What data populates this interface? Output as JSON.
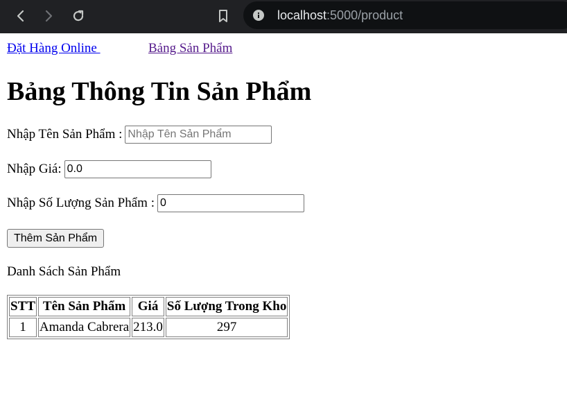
{
  "browser": {
    "url_host": "localhost",
    "url_path": ":5000/product"
  },
  "nav": {
    "order_link": "Đặt Hàng Online ",
    "table_link": "Bảng Sản Phẩm"
  },
  "heading": "Bảng Thông Tin Sản Phẩm",
  "form": {
    "name_label": "Nhập Tên Sản Phẩm :",
    "name_placeholder": "Nhập Tên Sản Phẩm",
    "name_value": "",
    "price_label": "Nhập Giá:",
    "price_value": "0.0",
    "qty_label": "Nhập Số Lượng Sản Phẩm :",
    "qty_value": "0",
    "submit_label": "Thêm Sản Phẩm"
  },
  "list_title": "Danh Sách Sản Phẩm",
  "table": {
    "headers": [
      "STT",
      "Tên Sản Phẩm",
      "Giá",
      "Số Lượng Trong Kho"
    ],
    "rows": [
      [
        "1",
        "Amanda Cabrera",
        "213.0",
        "297"
      ]
    ]
  }
}
